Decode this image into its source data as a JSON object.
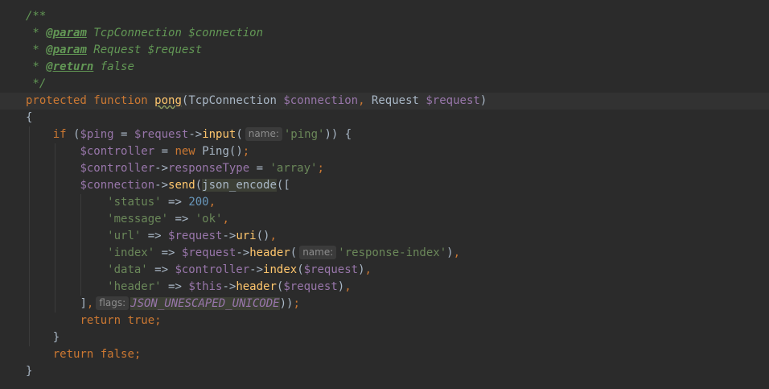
{
  "editor": {
    "language": "php",
    "colors": {
      "background": "#2b2b2b",
      "current_line": "#323232",
      "doc_comment": "#629755",
      "keyword": "#cc7832",
      "variable": "#9876aa",
      "function": "#ffc66d",
      "string": "#6a8759",
      "number": "#6897bb",
      "text": "#a9b7c6"
    },
    "gutter_icon": "lightbulb-icon",
    "doc": {
      "open": "/**",
      "param1_star": " * ",
      "param_tag": "@param",
      "param1_type": " TcpConnection ",
      "param1_var": "$connection",
      "param2_type": " Request ",
      "param2_var": "$request",
      "return_tag": "@return",
      "return_value": " false",
      "close": " */"
    },
    "sig": {
      "modifier": "protected",
      "keyword": "function",
      "name": "pong",
      "param1_type": "TcpConnection",
      "param1_var": "$connection",
      "param2_type": "Request",
      "param2_var": "$request"
    },
    "body": {
      "open_brace": "{",
      "if_kw": "if",
      "ping_var": "$ping",
      "request_var": "$request",
      "input_fn": "input",
      "hint_name": "name:",
      "ping_str": "'ping'",
      "controller_var": "$controller",
      "new_kw": "new",
      "ping_class": "Ping",
      "response_type_prop": "responseType",
      "array_str": "'array'",
      "connection_var": "$connection",
      "send_fn": "send",
      "json_encode_fn": "json_encode",
      "status_key": "'status'",
      "status_val": "200",
      "message_key": "'message'",
      "message_val": "'ok'",
      "url_key": "'url'",
      "uri_fn": "uri",
      "index_key": "'index'",
      "header_fn": "header",
      "response_index_str": "'response-index'",
      "data_key": "'data'",
      "index_fn": "index",
      "header_key": "'header'",
      "this_var": "$this",
      "hint_flags": "flags:",
      "json_const": "JSON_UNESCAPED_UNICODE",
      "return_kw": "return",
      "true_kw": "true",
      "false_kw": "false",
      "close_brace": "}"
    }
  }
}
